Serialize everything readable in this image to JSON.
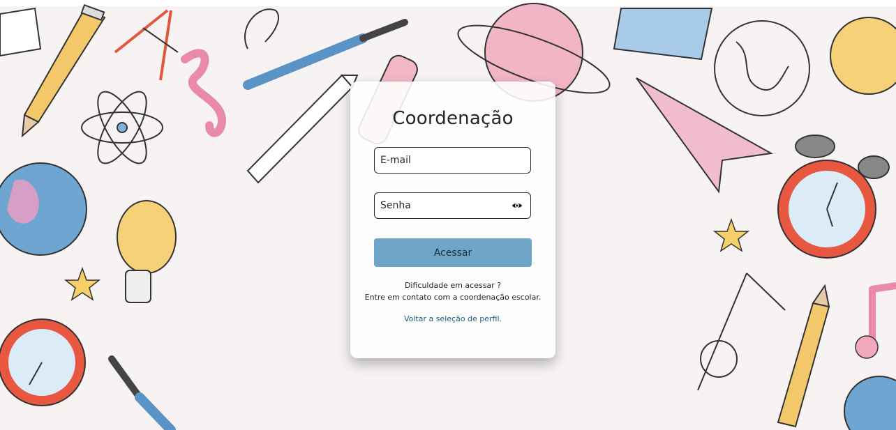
{
  "login": {
    "title": "Coordenação",
    "email_placeholder": "E-mail",
    "password_placeholder": "Senha",
    "submit_label": "Acessar",
    "help_line1": "Dificuldade em acessar ?",
    "help_line2": "Entre em contato com a coordenação escolar.",
    "back_link": "Voltar a seleção de perfil."
  },
  "icons": {
    "password_toggle": "eye-icon"
  },
  "colors": {
    "primary_button": "#6fa5c7",
    "link": "#1b5c78",
    "background": "#f7f3f3"
  }
}
